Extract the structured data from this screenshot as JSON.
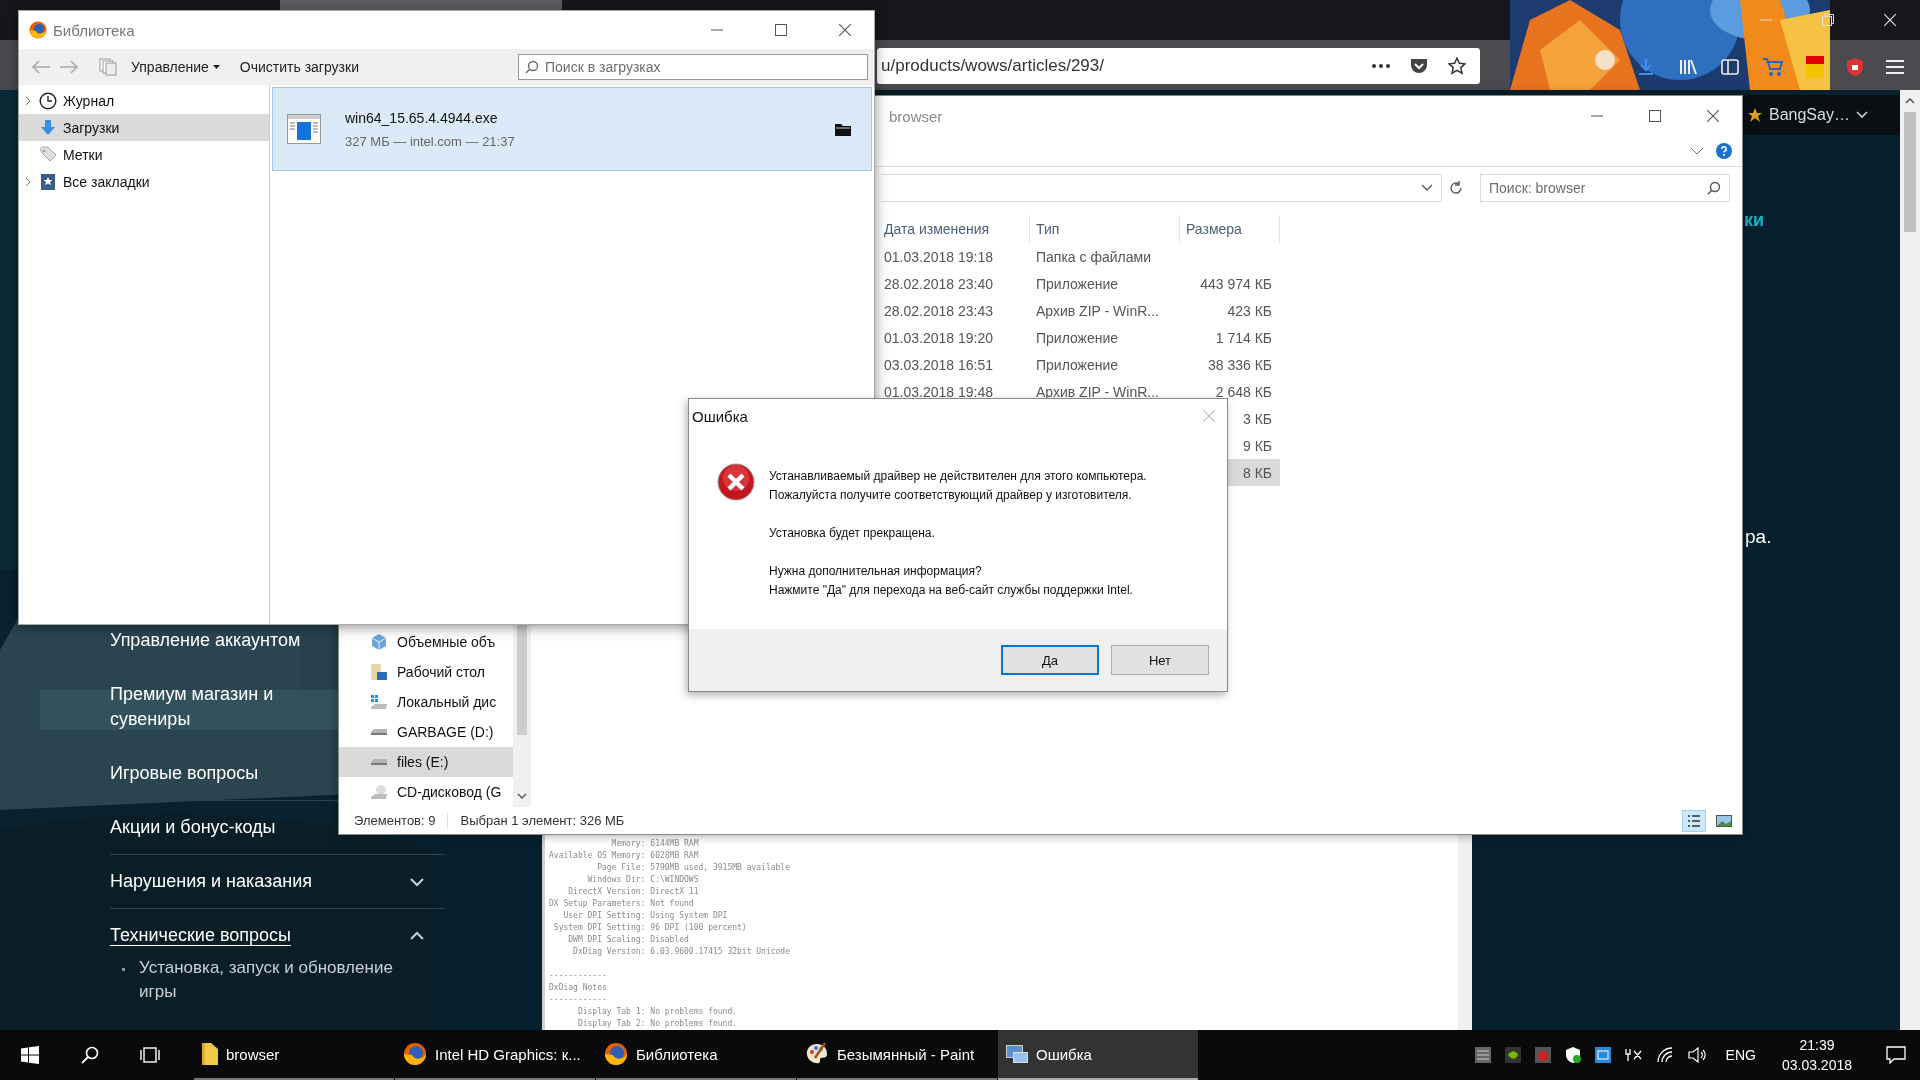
{
  "browser": {
    "url": "u/products/wows/articles/293/",
    "account": "BangSay…",
    "site_nav": [
      {
        "label": "Управление аккаунтом"
      },
      {
        "label": "Премиум магазин и сувениры"
      },
      {
        "label": "Игровые вопросы"
      },
      {
        "label": "Акции и бонус-коды"
      },
      {
        "label": "Нарушения и наказания",
        "expanded": false
      },
      {
        "label": "Технические вопросы",
        "expanded": true,
        "children": [
          {
            "label": "Установка, запуск и обновление игры"
          }
        ]
      }
    ],
    "heading_fragment": "ки",
    "text_fragment": "ра.",
    "console_lines": [
      {
        "kind": "pair",
        "label": "Memory:",
        "value": "6144MB RAM"
      },
      {
        "kind": "pair",
        "label": "Available OS Memory:",
        "value": "6028MB RAM"
      },
      {
        "kind": "pair",
        "label": "Page File:",
        "value": "5790MB used, 3915MB available"
      },
      {
        "kind": "pair",
        "label": "Windows Dir:",
        "value": "C:\\WINDOWS"
      },
      {
        "kind": "pair",
        "label": "DirectX Version:",
        "value": "DirectX 11"
      },
      {
        "kind": "pair",
        "label": "DX Setup Parameters:",
        "value": "Not found"
      },
      {
        "kind": "pair",
        "label": "User DPI Setting:",
        "value": "Using System DPI"
      },
      {
        "kind": "pair",
        "label": "System DPI Setting:",
        "value": "96 DPI (100 percent)"
      },
      {
        "kind": "pair",
        "label": "DWM DPI Scaling:",
        "value": "Disabled"
      },
      {
        "kind": "pair",
        "label": "DxDiag Version:",
        "value": "6.03.9600.17415 32bit Unicode"
      },
      {
        "kind": "rule",
        "text": "------------"
      },
      {
        "kind": "heading",
        "text": "DxDiag Notes"
      },
      {
        "kind": "rule",
        "text": "------------"
      },
      {
        "kind": "pair",
        "label": "Display Tab 1:",
        "value": "No problems found."
      },
      {
        "kind": "pair",
        "label": "Display Tab 2:",
        "value": "No problems found."
      }
    ]
  },
  "library": {
    "title": "Библиотека",
    "manage": "Управление",
    "clear": "Очистить загрузки",
    "search": {
      "placeholder": "Поиск в загрузках"
    },
    "sidebar": [
      {
        "label": "Журнал",
        "kind": "history",
        "expandable": true,
        "selected": false
      },
      {
        "label": "Загрузки",
        "kind": "downloads",
        "expandable": false,
        "selected": true
      },
      {
        "label": "Метки",
        "kind": "tags",
        "expandable": false,
        "selected": false
      },
      {
        "label": "Все закладки",
        "kind": "bookmarks",
        "expandable": true,
        "selected": false
      }
    ],
    "downloads": [
      {
        "name": "win64_15.65.4.4944.exe",
        "meta": "327 МБ — intel.com — 21:37",
        "selected": true
      }
    ]
  },
  "explorer": {
    "title": "browser",
    "search": {
      "placeholder": "Поиск: browser"
    },
    "columns": [
      "Дата изменения",
      "Тип",
      "Размера"
    ],
    "rows": [
      {
        "date": "01.03.2018 19:18",
        "type": "Папка с файлами",
        "selected": false
      },
      {
        "date": "28.02.2018 23:40",
        "type": "Приложение",
        "size": "443 974 КБ",
        "selected": false
      },
      {
        "date": "28.02.2018 23:43",
        "type": "Архив ZIP - WinR...",
        "size": "423 КБ",
        "selected": false
      },
      {
        "date": "01.03.2018 19:20",
        "type": "Приложение",
        "size": "1 714 КБ",
        "selected": false
      },
      {
        "date": "03.03.2018 16:51",
        "type": "Приложение",
        "size": "38 336 КБ",
        "selected": false
      },
      {
        "date": "01.03.2018 19:48",
        "type": "Архив ZIP - WinR...",
        "size": "2 648 КБ",
        "selected": false
      },
      {
        "size": "3 КБ",
        "selected": false
      },
      {
        "size": "9 КБ",
        "selected": false
      },
      {
        "size": "8 КБ",
        "selected": true
      }
    ],
    "nav": [
      {
        "label": "Объемные объ",
        "kind": "objects",
        "selected": false
      },
      {
        "label": "Рабочий стол",
        "kind": "desktop",
        "selected": false
      },
      {
        "label": "Локальный дис",
        "kind": "system",
        "selected": false
      },
      {
        "label": "GARBAGE (D:)",
        "kind": "drive",
        "selected": false
      },
      {
        "label": "files (E:)",
        "kind": "drive",
        "selected": true
      },
      {
        "label": "CD-дисковод (G",
        "kind": "optical",
        "selected": false
      }
    ],
    "status": [
      "Элементов: 9",
      "Выбран 1 элемент: 326 МБ"
    ]
  },
  "dialog": {
    "title": "Ошибка",
    "kind": "error",
    "paragraphs": [
      "Устанавливаемый драйвер не действителен для этого компьютера.\nПожалуйста получите соответствующий драйвер у изготовителя.",
      "Установка будет прекращена.",
      "Нужна дополнительная информация?\nНажмите \"Да\" для перехода на веб-сайт службы поддержки Intel."
    ],
    "buttons": [
      {
        "label": "Да",
        "default": true
      },
      {
        "label": "Нет",
        "default": false
      }
    ]
  },
  "taskbar": {
    "items": [
      {
        "label": "browser",
        "kind": "explorer",
        "selected": false
      },
      {
        "label": "Intel HD Graphics: к...",
        "kind": "browser",
        "selected": false
      },
      {
        "label": "Библиотека",
        "kind": "browser",
        "selected": false
      },
      {
        "label": "Безымянный - Paint",
        "kind": "paint",
        "selected": false
      },
      {
        "label": "Ошибка",
        "kind": "installer",
        "selected": true
      }
    ],
    "language": "ENG",
    "time": "21:39",
    "date": "03.03.2018"
  }
}
